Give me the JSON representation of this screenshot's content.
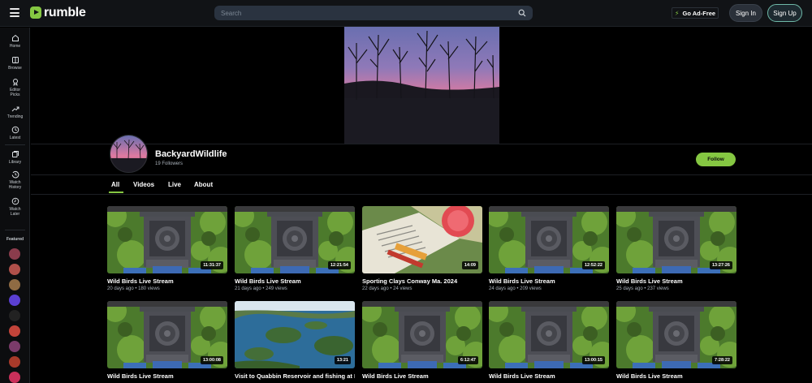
{
  "header": {
    "logo_text": "rumble",
    "search_placeholder": "Search",
    "ad_free_label": "Go Ad-Free",
    "sign_in_label": "Sign In",
    "sign_up_label": "Sign Up"
  },
  "sidebar": {
    "items": [
      {
        "label": "Home",
        "icon": "home-icon"
      },
      {
        "label": "Browse",
        "icon": "browse-icon"
      },
      {
        "label": "Editor Picks",
        "icon": "editor-picks-icon"
      },
      {
        "label": "Trending",
        "icon": "trending-icon"
      },
      {
        "label": "Latest",
        "icon": "clock-icon"
      },
      {
        "label": "Library",
        "icon": "library-icon"
      },
      {
        "label": "Watch History",
        "icon": "history-icon"
      },
      {
        "label": "Watch Later",
        "icon": "watch-later-icon"
      }
    ],
    "featured_label": "Featured",
    "featured_colors": [
      "#8a3c4c",
      "#b0504a",
      "#8f6b43",
      "#5a3fd1",
      "#222222",
      "#c2443a",
      "#7b3b6a",
      "#a83a2a",
      "#c9305a"
    ]
  },
  "channel": {
    "name": "BackyardWildlife",
    "followers": "19 Followers",
    "follow_label": "Follow"
  },
  "tabs": [
    "All",
    "Videos",
    "Live",
    "About"
  ],
  "videos": [
    {
      "title": "Wild Birds Live Stream",
      "meta": "20 days ago • 180 views",
      "duration": "11:31:37",
      "kind": "feeder"
    },
    {
      "title": "Wild Birds Live Stream",
      "meta": "21 days ago • 249 views",
      "duration": "12:21:54",
      "kind": "feeder"
    },
    {
      "title": "Sporting Clays Conway Ma. 2024",
      "meta": "22 days ago • 24 views",
      "duration": "14:09",
      "kind": "clays"
    },
    {
      "title": "Wild Birds Live Stream",
      "meta": "24 days ago • 209 views",
      "duration": "12:52:22",
      "kind": "feeder"
    },
    {
      "title": "Wild Birds Live Stream",
      "meta": "25 days ago • 237 views",
      "duration": "13:27:26",
      "kind": "feeder"
    },
    {
      "title": "Wild Birds Live Stream",
      "meta": "",
      "duration": "13:00:08",
      "kind": "feeder"
    },
    {
      "title": "Visit to Quabbin Reservoir and fishing at Peppermill Pond!",
      "meta": "",
      "duration": "13:21",
      "kind": "lake"
    },
    {
      "title": "Wild Birds Live Stream",
      "meta": "",
      "duration": "6:12:47",
      "kind": "feeder"
    },
    {
      "title": "Wild Birds Live Stream",
      "meta": "",
      "duration": "13:00:15",
      "kind": "feeder"
    },
    {
      "title": "Wild Birds Live Stream",
      "meta": "",
      "duration": "7:28:22",
      "kind": "feeder"
    }
  ]
}
